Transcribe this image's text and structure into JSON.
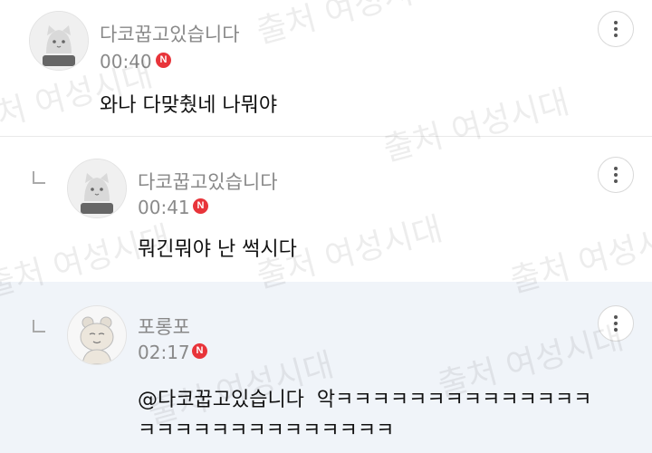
{
  "comments": [
    {
      "author": "다코꿉고있습니다",
      "time": "00:40",
      "badge": "N",
      "text": "와나 다맞췄네 나뭐야",
      "is_reply": false
    },
    {
      "author": "다코꿉고있습니다",
      "time": "00:41",
      "badge": "N",
      "text": "뭐긴뭐야 난 썩시다",
      "is_reply": true
    },
    {
      "author": "포롱포",
      "time": "02:17",
      "badge": "N",
      "mention": "@다코꿉고있습니다",
      "text_line1": "악ㅋㅋㅋㅋㅋㅋㅋㅋㅋㅋㅋㅋㅋㅋ",
      "text_line2": "ㅋㅋㅋㅋㅋㅋㅋㅋㅋㅋㅋㅋㅋㅋ",
      "is_reply": true
    }
  ],
  "watermark": "출처 여성시대",
  "colors": {
    "badge": "#e8343a",
    "selected_bg": "#f0f4f9",
    "meta_text": "#888888"
  },
  "icons": {
    "more": "more-vertical-icon",
    "reply": "reply-arrow-icon"
  }
}
